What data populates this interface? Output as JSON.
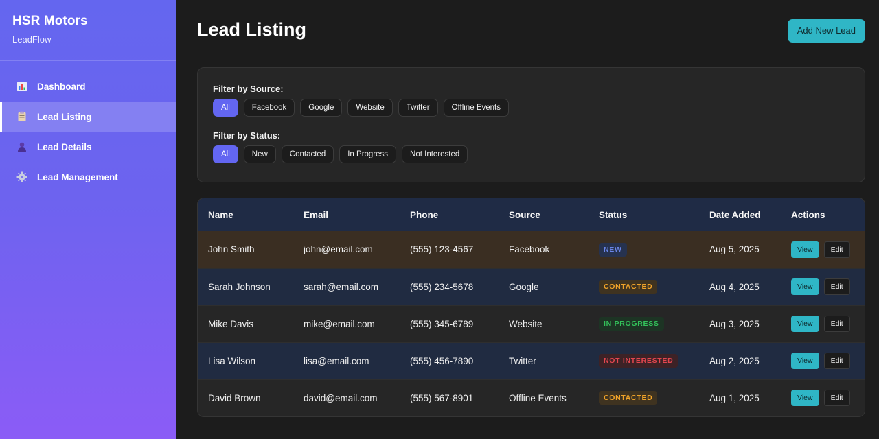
{
  "brand": {
    "title": "HSR Motors",
    "subtitle": "LeadFlow"
  },
  "sidebar": {
    "items": [
      {
        "label": "Dashboard",
        "icon": "bar-chart-icon",
        "active": false
      },
      {
        "label": "Lead Listing",
        "icon": "clipboard-icon",
        "active": true
      },
      {
        "label": "Lead Details",
        "icon": "user-icon",
        "active": false
      },
      {
        "label": "Lead Management",
        "icon": "gear-icon",
        "active": false
      }
    ]
  },
  "header": {
    "title": "Lead Listing",
    "add_button": "Add New Lead"
  },
  "filters": {
    "source_label": "Filter by Source:",
    "source_options": [
      "All",
      "Facebook",
      "Google",
      "Website",
      "Twitter",
      "Offline Events"
    ],
    "status_label": "Filter by Status:",
    "status_options": [
      "All",
      "New",
      "Contacted",
      "In Progress",
      "Not Interested"
    ]
  },
  "table": {
    "columns": [
      "Name",
      "Email",
      "Phone",
      "Source",
      "Status",
      "Date Added",
      "Actions"
    ],
    "rows": [
      {
        "name": "John Smith",
        "email": "john@email.com",
        "phone": "(555) 123-4567",
        "source": "Facebook",
        "status": "NEW",
        "date": "Aug 5, 2025"
      },
      {
        "name": "Sarah Johnson",
        "email": "sarah@email.com",
        "phone": "(555) 234-5678",
        "source": "Google",
        "status": "CONTACTED",
        "date": "Aug 4, 2025"
      },
      {
        "name": "Mike Davis",
        "email": "mike@email.com",
        "phone": "(555) 345-6789",
        "source": "Website",
        "status": "IN PROGRESS",
        "date": "Aug 3, 2025"
      },
      {
        "name": "Lisa Wilson",
        "email": "lisa@email.com",
        "phone": "(555) 456-7890",
        "source": "Twitter",
        "status": "NOT INTERESTED",
        "date": "Aug 2, 2025"
      },
      {
        "name": "David Brown",
        "email": "david@email.com",
        "phone": "(555) 567-8901",
        "source": "Offline Events",
        "status": "CONTACTED",
        "date": "Aug 1, 2025"
      }
    ],
    "view_label": "View",
    "edit_label": "Edit"
  },
  "colors": {
    "accent": "#6366f1",
    "teal": "#2fb6c6",
    "status_new": "#6b86e8",
    "status_contacted": "#f0a329",
    "status_in_progress": "#33c25a",
    "status_not_interested": "#e3464f"
  }
}
